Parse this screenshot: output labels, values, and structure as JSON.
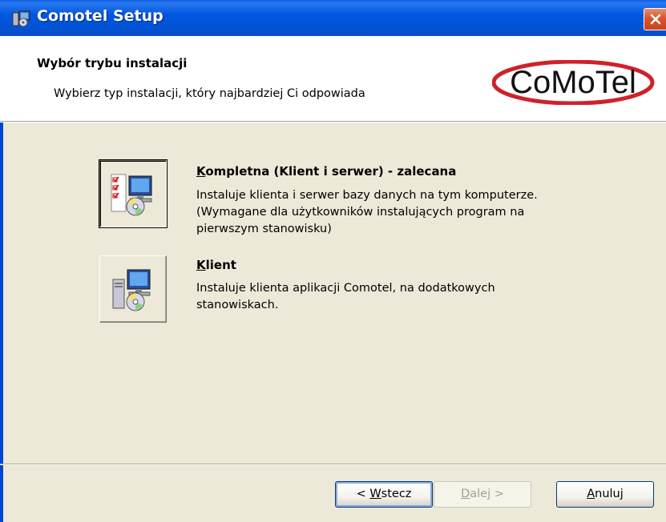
{
  "window": {
    "title": "Comotel Setup",
    "colors": {
      "titlebar": "#0058E0",
      "close": "#D8552D",
      "background": "#ECE9D8"
    }
  },
  "banner": {
    "heading": "Wybór trybu instalacji",
    "subtitle": "Wybierz typ instalacji, który najbardziej Ci odpowiada",
    "logo_text": "CoMoTel"
  },
  "options": [
    {
      "mnemonic": "K",
      "title_rest": "ompletna (Klient i serwer) - zalecana",
      "description_lines": [
        "Instaluje klienta i serwer bazy danych na tym komputerze.",
        "(Wymagane dla użytkowników instalujących program na",
        "pierwszym stanowisku)"
      ],
      "icon": "complete-install-icon",
      "selected": true
    },
    {
      "mnemonic": "K",
      "title_rest": "lient",
      "description_lines": [
        "Instaluje klienta aplikacji Comotel, na dodatkowych",
        "stanowiskach."
      ],
      "icon": "client-install-icon",
      "selected": false
    }
  ],
  "buttons": {
    "back": {
      "pre": "< ",
      "mnemonic": "W",
      "rest": "stecz"
    },
    "next": {
      "mnemonic": "D",
      "rest": "alej >",
      "disabled": true
    },
    "cancel": {
      "mnemonic": "A",
      "rest": "nuluj"
    }
  }
}
